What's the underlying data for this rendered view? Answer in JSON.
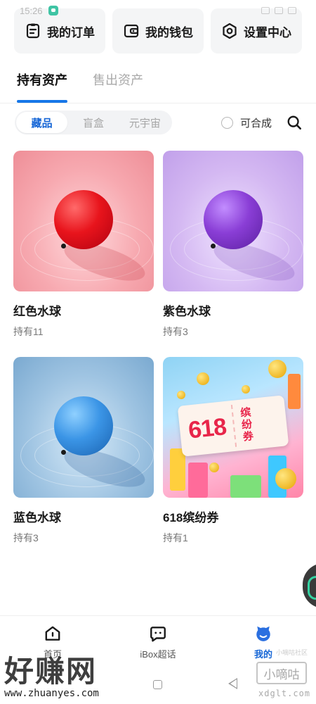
{
  "status_bar": {
    "time": "15:26"
  },
  "quick_links": [
    {
      "label": "我的订单",
      "icon": "order-list-icon"
    },
    {
      "label": "我的钱包",
      "icon": "wallet-icon"
    },
    {
      "label": "设置中心",
      "icon": "settings-hexagon-icon"
    }
  ],
  "tabs": [
    {
      "label": "持有资产",
      "active": true
    },
    {
      "label": "售出资产",
      "active": false
    }
  ],
  "segments": [
    {
      "label": "藏品",
      "active": true
    },
    {
      "label": "盲盒",
      "active": false
    },
    {
      "label": "元宇宙",
      "active": false
    }
  ],
  "combinable_label": "可合成",
  "items": [
    {
      "name": "红色水球",
      "count": "持有11"
    },
    {
      "name": "紫色水球",
      "count": "持有3"
    },
    {
      "name": "蓝色水球",
      "count": "持有3"
    },
    {
      "name": "618缤纷券",
      "count": "持有1"
    }
  ],
  "coupon_art": {
    "number": "618",
    "side_text": [
      "缤",
      "纷",
      "券"
    ]
  },
  "bottom_nav": [
    {
      "label": "首页",
      "icon": "home-icon"
    },
    {
      "label": "iBox超话",
      "icon": "chat-bubble-icon"
    },
    {
      "label": "我的",
      "icon": "profile-mascot-icon",
      "active": true
    }
  ],
  "watermarks": {
    "left_big": "好赚网",
    "left_url": "www.zhuanyes.com",
    "right_box": "小嘀咕",
    "right_url": "xdglt.com",
    "right_small": "小嘀咕社区"
  },
  "colors": {
    "accent": "#1677e8",
    "segment_active": "#1666d6",
    "card_bg": "#f4f5f6"
  }
}
